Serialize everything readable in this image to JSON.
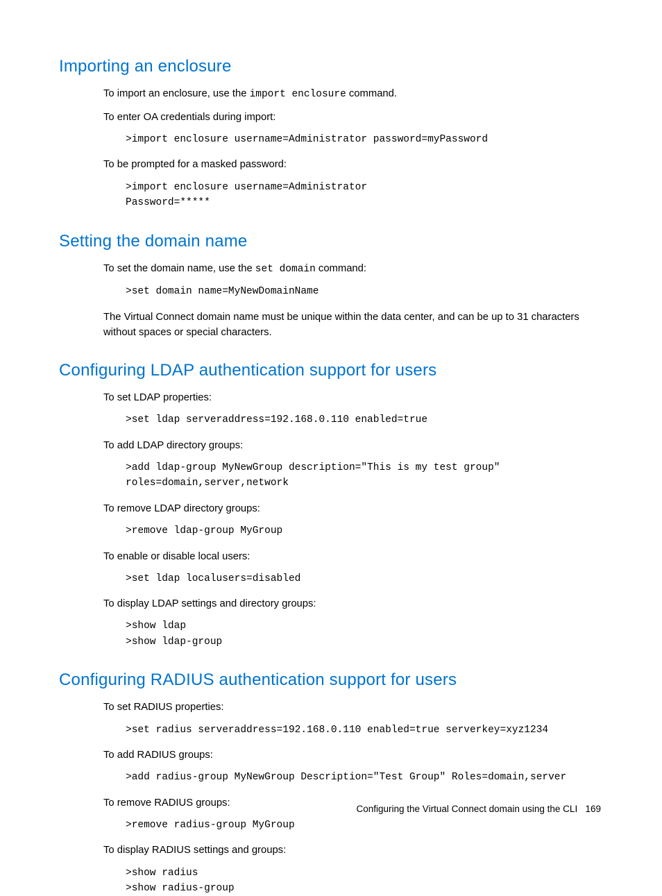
{
  "sections": [
    {
      "heading": "Importing an enclosure",
      "blocks": [
        {
          "type": "para_code",
          "before": "To import an enclosure, use the ",
          "code": "import enclosure",
          "after": " command."
        },
        {
          "type": "para",
          "text": "To enter OA credentials during import:"
        },
        {
          "type": "code",
          "text": ">import enclosure username=Administrator password=myPassword"
        },
        {
          "type": "para",
          "text": "To be prompted for a masked password:"
        },
        {
          "type": "code",
          "text": ">import enclosure username=Administrator\nPassword=*****"
        }
      ]
    },
    {
      "heading": "Setting the domain name",
      "blocks": [
        {
          "type": "para_code",
          "before": "To set the domain name, use the ",
          "code": "set domain",
          "after": " command:"
        },
        {
          "type": "code",
          "text": ">set domain name=MyNewDomainName"
        },
        {
          "type": "para",
          "text": "The Virtual Connect domain name must be unique within the data center, and can be up to 31 characters without spaces or special characters."
        }
      ]
    },
    {
      "heading": "Configuring LDAP authentication support for users",
      "blocks": [
        {
          "type": "para",
          "text": "To set LDAP properties:"
        },
        {
          "type": "code",
          "text": ">set ldap serveraddress=192.168.0.110 enabled=true"
        },
        {
          "type": "para",
          "text": "To add LDAP directory groups:"
        },
        {
          "type": "code",
          "text": ">add ldap-group MyNewGroup description=\"This is my test group\"\nroles=domain,server,network"
        },
        {
          "type": "para",
          "text": "To remove LDAP directory groups:"
        },
        {
          "type": "code",
          "text": ">remove ldap-group MyGroup"
        },
        {
          "type": "para",
          "text": "To enable or disable local users:"
        },
        {
          "type": "code",
          "text": ">set ldap localusers=disabled"
        },
        {
          "type": "para",
          "text": "To display LDAP settings and directory groups:"
        },
        {
          "type": "code",
          "text": ">show ldap\n>show ldap-group"
        }
      ]
    },
    {
      "heading": "Configuring RADIUS authentication support for users",
      "blocks": [
        {
          "type": "para",
          "text": "To set RADIUS properties:"
        },
        {
          "type": "code",
          "text": ">set radius serveraddress=192.168.0.110 enabled=true serverkey=xyz1234"
        },
        {
          "type": "para",
          "text": "To add RADIUS groups:"
        },
        {
          "type": "code",
          "text": ">add radius-group MyNewGroup Description=\"Test Group\" Roles=domain,server"
        },
        {
          "type": "para",
          "text": "To remove RADIUS groups:"
        },
        {
          "type": "code",
          "text": ">remove radius-group MyGroup"
        },
        {
          "type": "para",
          "text": "To display RADIUS settings and groups:"
        },
        {
          "type": "code",
          "text": ">show radius\n>show radius-group"
        }
      ]
    }
  ],
  "footer": {
    "text": "Configuring the Virtual Connect domain using the CLI",
    "page": "169"
  }
}
